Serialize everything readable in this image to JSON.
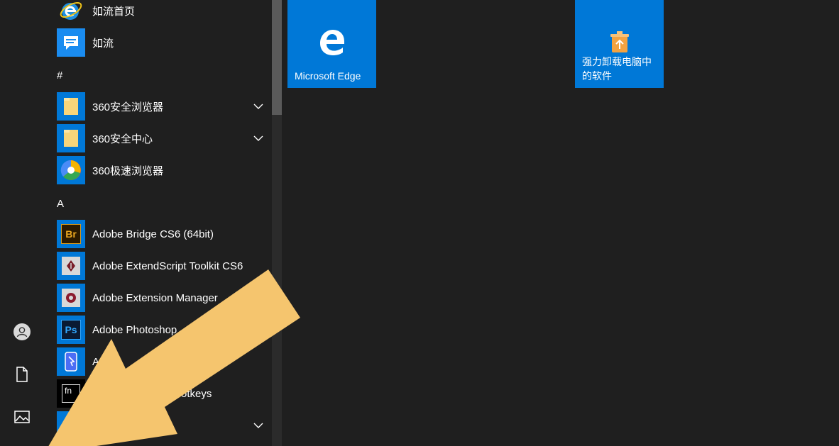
{
  "colors": {
    "background": "#1f1f1f",
    "tile_blue": "#0078d7",
    "overlay_arrow": "#f5c56e"
  },
  "rail": {
    "items": [
      {
        "name": "user-account",
        "icon": "user-icon"
      },
      {
        "name": "documents",
        "icon": "document-icon"
      },
      {
        "name": "pictures",
        "icon": "pictures-icon"
      }
    ]
  },
  "applist": {
    "rows": [
      {
        "label": "如流首页",
        "icon": "ie-icon"
      },
      {
        "label": "如流",
        "icon": "ruliu-icon"
      },
      {
        "header": "#"
      },
      {
        "label": "360安全浏览器",
        "icon": "folder-icon",
        "expandable": true
      },
      {
        "label": "360安全中心",
        "icon": "folder-icon",
        "expandable": true
      },
      {
        "label": "360极速浏览器",
        "icon": "360-chrome-icon"
      },
      {
        "header": "A"
      },
      {
        "label": "Adobe Bridge CS6 (64bit)",
        "icon": "adobe-bridge-icon"
      },
      {
        "label": "Adobe ExtendScript Toolkit CS6",
        "icon": "adobe-extendscript-icon"
      },
      {
        "label": "Adobe Extension Manager",
        "icon": "adobe-extension-manager-icon"
      },
      {
        "label": "Adobe Photoshop",
        "icon": "adobe-photoshop-icon"
      },
      {
        "label": "A",
        "icon": "app-icon"
      },
      {
        "label": "otkeys",
        "icon": "fn-hotkeys-icon"
      },
      {
        "label": "",
        "icon": "folder-icon",
        "expandable": true
      }
    ]
  },
  "tiles": [
    {
      "label": "Microsoft Edge",
      "icon": "edge-icon"
    },
    {
      "label": "强力卸载电脑中的软件",
      "icon": "uninstall-icon"
    }
  ]
}
